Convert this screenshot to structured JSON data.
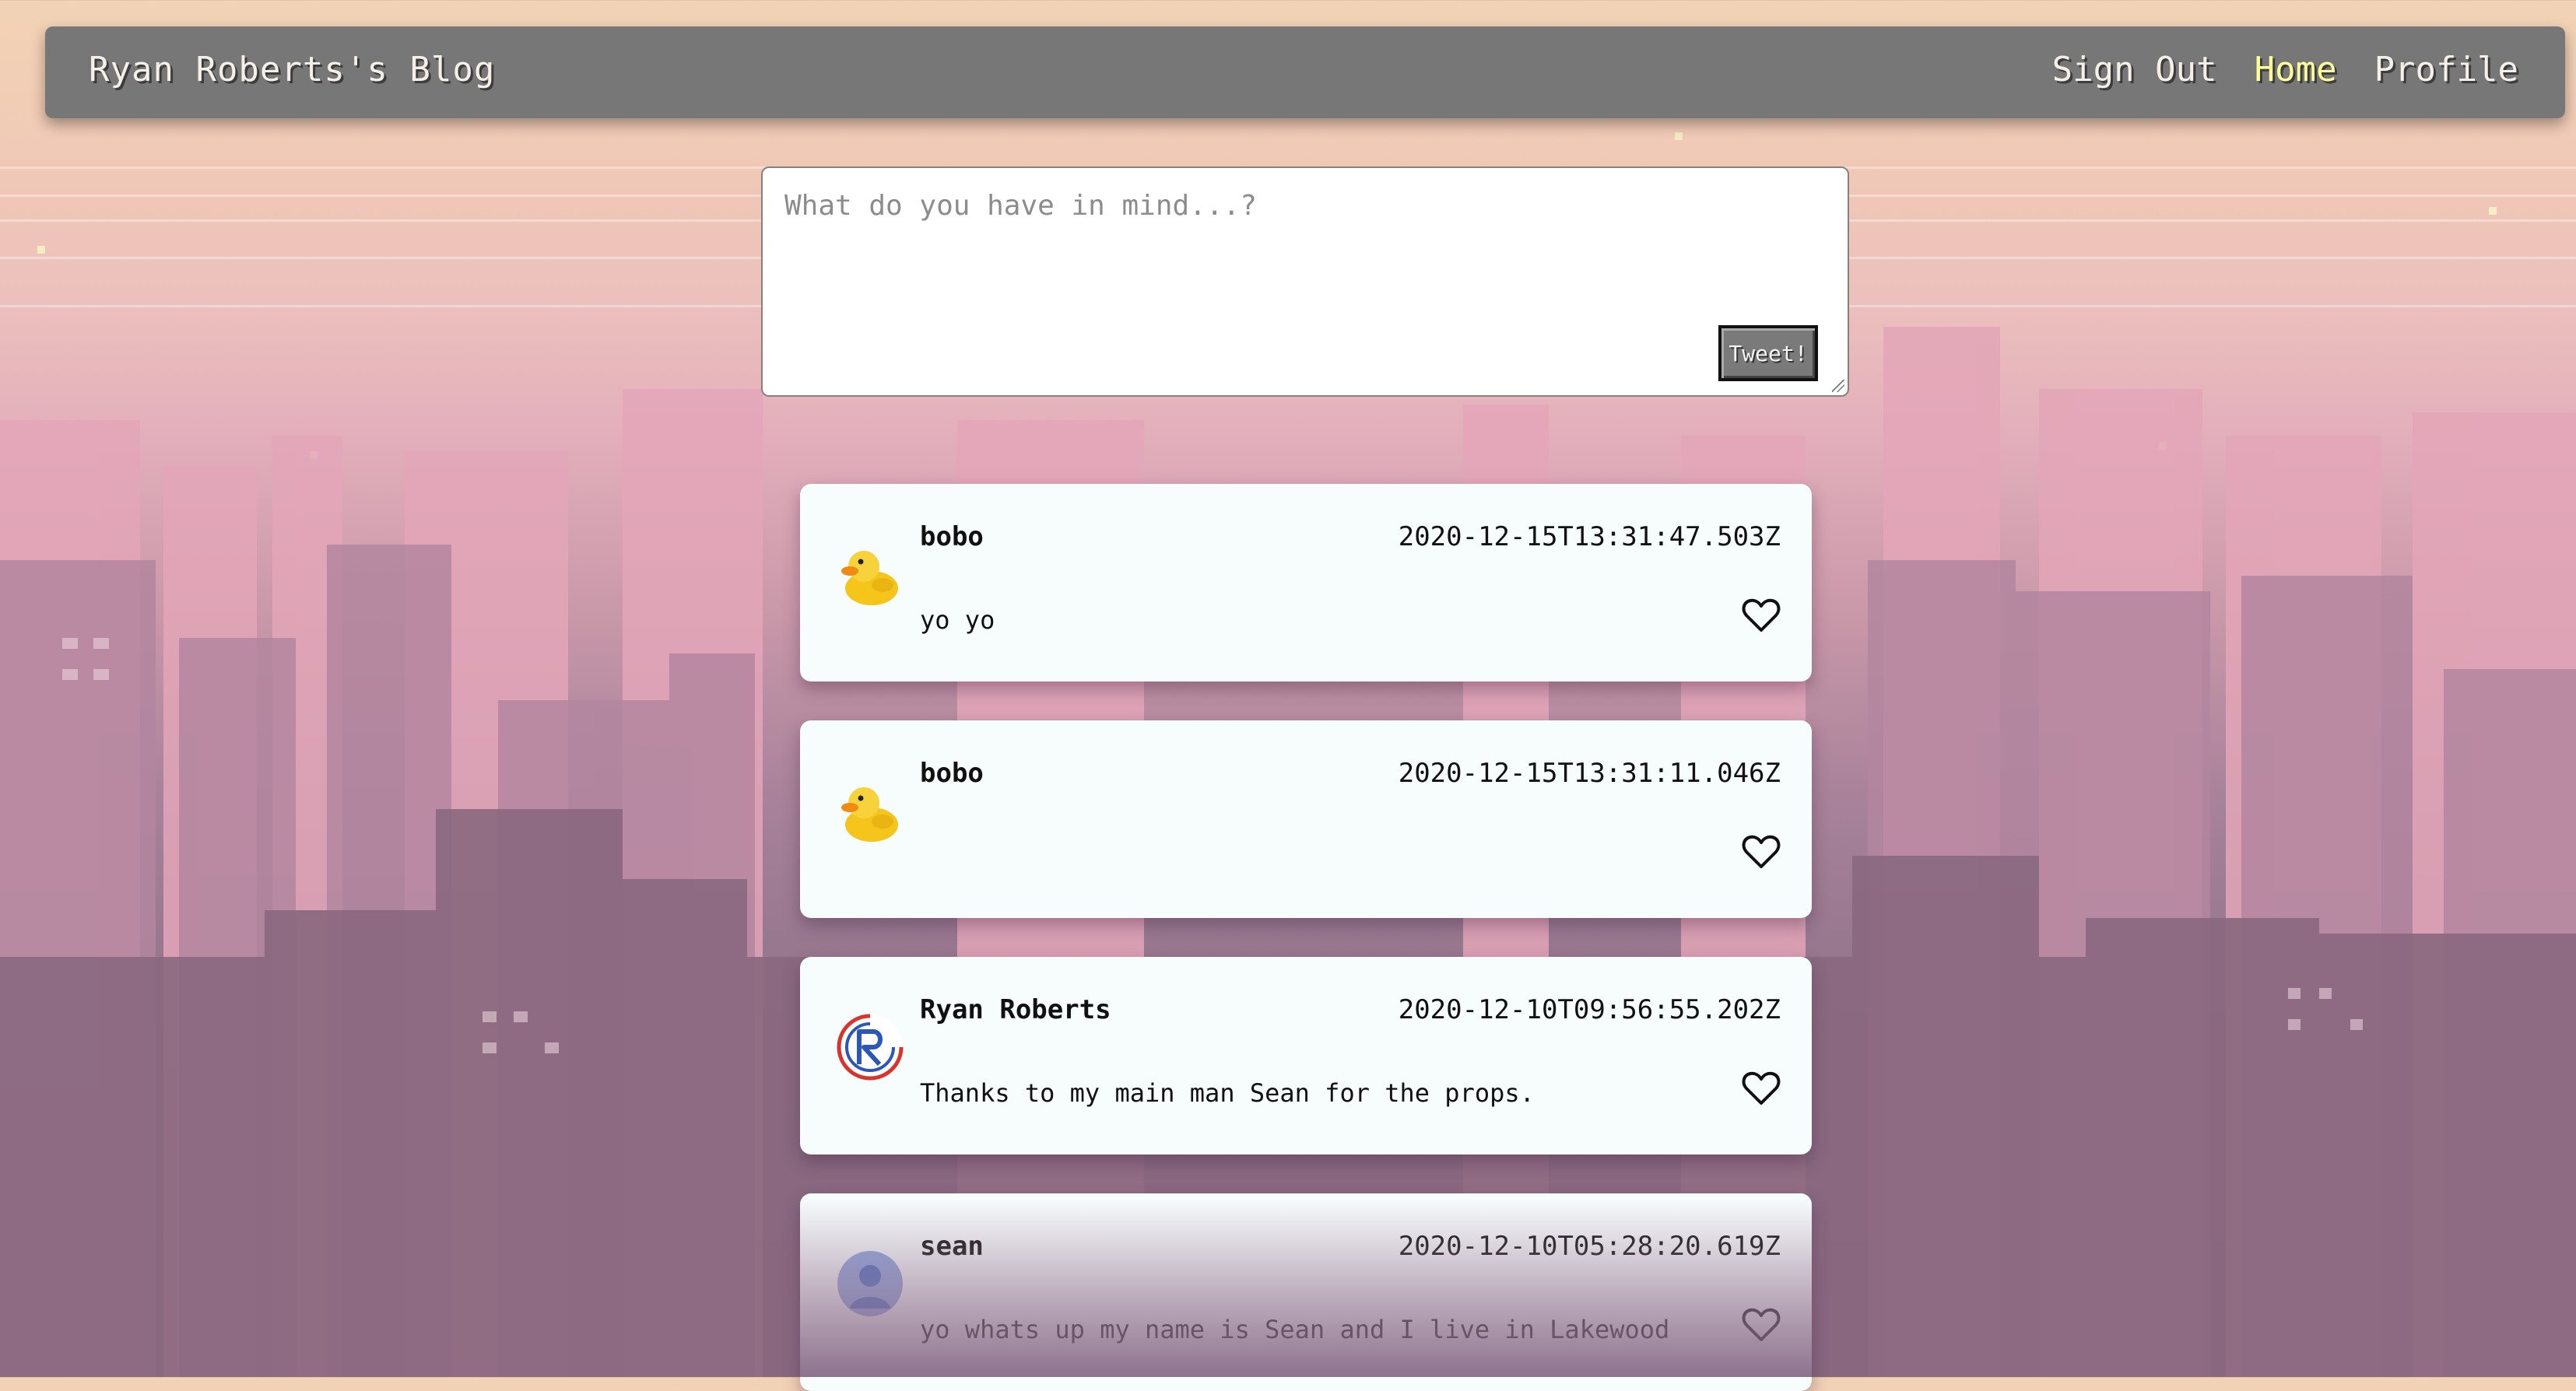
{
  "navbar": {
    "brand": "Ryan Roberts's Blog",
    "links": [
      {
        "label": "Sign Out",
        "active": false
      },
      {
        "label": "Home",
        "active": true
      },
      {
        "label": "Profile",
        "active": false
      }
    ]
  },
  "composer": {
    "placeholder": "What do you have in mind...?",
    "button_label": "Tweet!"
  },
  "feed": {
    "posts": [
      {
        "username": "bobo",
        "timestamp": "2020-12-15T13:31:47.503Z",
        "text": "yo yo",
        "avatar": "rubber-duck-avatar"
      },
      {
        "username": "bobo",
        "timestamp": "2020-12-15T13:31:11.046Z",
        "text": "",
        "avatar": "rubber-duck-avatar"
      },
      {
        "username": "Ryan Roberts",
        "timestamp": "2020-12-10T09:56:55.202Z",
        "text": "Thanks to my main man Sean for the props.",
        "avatar": "r-logo-avatar"
      },
      {
        "username": "sean",
        "timestamp": "2020-12-10T05:28:20.619Z",
        "text": "yo whats up my name is Sean and I live in Lakewood",
        "avatar": "default-user-avatar"
      }
    ]
  },
  "colors": {
    "navbar_bg": "#777777",
    "nav_active": "#ffff9a",
    "card_bg": "#f7fcfd"
  }
}
